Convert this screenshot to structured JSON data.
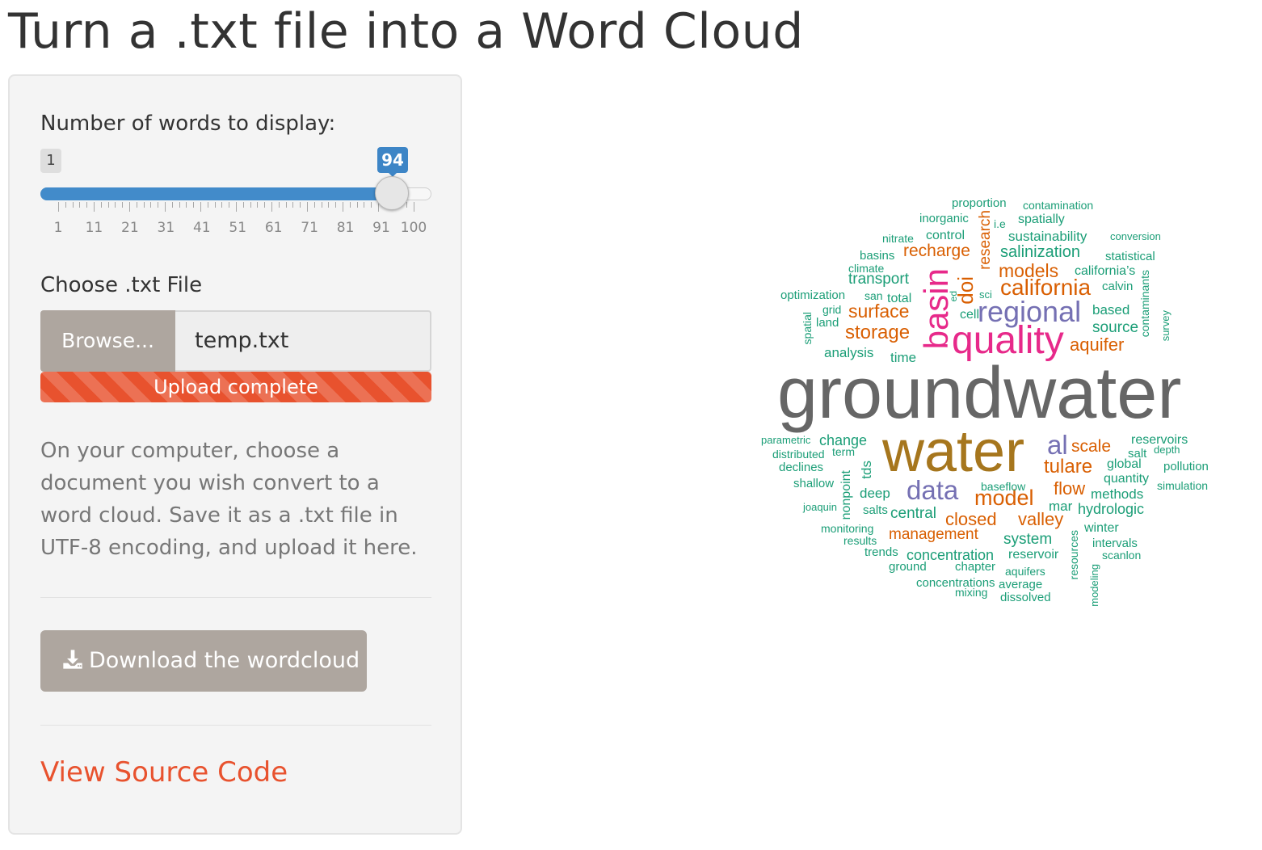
{
  "page": {
    "title": "Turn a .txt file into a Word Cloud"
  },
  "sidebar": {
    "slider": {
      "label": "Number of words to display:",
      "min": 1,
      "max": 100,
      "value": 94,
      "min_label": "1",
      "value_label": "94",
      "tick_labels": [
        "1",
        "11",
        "21",
        "31",
        "41",
        "51",
        "61",
        "71",
        "81",
        "91",
        "100"
      ]
    },
    "file_input": {
      "label": "Choose .txt File",
      "browse_label": "Browse...",
      "filename": "temp.txt",
      "progress_text": "Upload complete"
    },
    "help_text": "On your computer, choose a document you wish convert to a word cloud. Save it as a .txt file in UTF-8 encoding, and upload it here.",
    "download_label": "Download the wordcloud",
    "source_link": "View Source Code"
  },
  "colors": {
    "accent_blue": "#428bca",
    "orange": "#e8522e",
    "button_gray": "#aea69f",
    "cloud_teal": "#1b9e77",
    "cloud_orange": "#d95f02",
    "cloud_purple": "#7570b3",
    "cloud_pink": "#e7298a",
    "cloud_olive": "#a6761d",
    "cloud_gray": "#666666"
  },
  "wordcloud": {
    "words": [
      {
        "text": "groundwater",
        "color": "#666666"
      },
      {
        "text": "water",
        "color": "#a6761d"
      },
      {
        "text": "quality",
        "color": "#e7298a"
      },
      {
        "text": "basin",
        "color": "#e7298a"
      },
      {
        "text": "regional",
        "color": "#7570b3"
      },
      {
        "text": "data",
        "color": "#7570b3"
      },
      {
        "text": "al",
        "color": "#7570b3"
      },
      {
        "text": "doi",
        "color": "#d95f02"
      },
      {
        "text": "model",
        "color": "#d95f02"
      },
      {
        "text": "california",
        "color": "#d95f02"
      },
      {
        "text": "models",
        "color": "#d95f02"
      },
      {
        "text": "storage",
        "color": "#d95f02"
      },
      {
        "text": "surface",
        "color": "#d95f02"
      },
      {
        "text": "aquifer",
        "color": "#d95f02"
      },
      {
        "text": "tulare",
        "color": "#d95f02"
      },
      {
        "text": "recharge",
        "color": "#d95f02"
      },
      {
        "text": "research",
        "color": "#d95f02"
      },
      {
        "text": "scale",
        "color": "#d95f02"
      },
      {
        "text": "flow",
        "color": "#d95f02"
      },
      {
        "text": "closed",
        "color": "#d95f02"
      },
      {
        "text": "valley",
        "color": "#d95f02"
      },
      {
        "text": "management",
        "color": "#d95f02"
      },
      {
        "text": "salinization",
        "color": "#1b9e77"
      },
      {
        "text": "transport",
        "color": "#1b9e77"
      },
      {
        "text": "source",
        "color": "#1b9e77"
      },
      {
        "text": "sustainability",
        "color": "#1b9e77"
      },
      {
        "text": "control",
        "color": "#1b9e77"
      },
      {
        "text": "analysis",
        "color": "#1b9e77"
      },
      {
        "text": "time",
        "color": "#1b9e77"
      },
      {
        "text": "cell",
        "color": "#1b9e77"
      },
      {
        "text": "total",
        "color": "#1b9e77"
      },
      {
        "text": "san",
        "color": "#1b9e77"
      },
      {
        "text": "based",
        "color": "#1b9e77"
      },
      {
        "text": "calvin",
        "color": "#1b9e77"
      },
      {
        "text": "california’s",
        "color": "#1b9e77"
      },
      {
        "text": "statistical",
        "color": "#1b9e77"
      },
      {
        "text": "conversion",
        "color": "#1b9e77"
      },
      {
        "text": "spatially",
        "color": "#1b9e77"
      },
      {
        "text": "i.e",
        "color": "#1b9e77"
      },
      {
        "text": "inorganic",
        "color": "#1b9e77"
      },
      {
        "text": "proportion",
        "color": "#1b9e77"
      },
      {
        "text": "contamination",
        "color": "#1b9e77"
      },
      {
        "text": "nitrate",
        "color": "#1b9e77"
      },
      {
        "text": "basins",
        "color": "#1b9e77"
      },
      {
        "text": "climate",
        "color": "#1b9e77"
      },
      {
        "text": "optimization",
        "color": "#1b9e77"
      },
      {
        "text": "grid",
        "color": "#1b9e77"
      },
      {
        "text": "land",
        "color": "#1b9e77"
      },
      {
        "text": "spatial",
        "color": "#1b9e77"
      },
      {
        "text": "ed",
        "color": "#1b9e77"
      },
      {
        "text": "sci",
        "color": "#1b9e77"
      },
      {
        "text": "contaminants",
        "color": "#1b9e77"
      },
      {
        "text": "survey",
        "color": "#1b9e77"
      },
      {
        "text": "change",
        "color": "#1b9e77"
      },
      {
        "text": "parametric",
        "color": "#1b9e77"
      },
      {
        "text": "distributed",
        "color": "#1b9e77"
      },
      {
        "text": "term",
        "color": "#1b9e77"
      },
      {
        "text": "declines",
        "color": "#1b9e77"
      },
      {
        "text": "tds",
        "color": "#1b9e77"
      },
      {
        "text": "shallow",
        "color": "#1b9e77"
      },
      {
        "text": "nonpoint",
        "color": "#1b9e77"
      },
      {
        "text": "deep",
        "color": "#1b9e77"
      },
      {
        "text": "joaquin",
        "color": "#1b9e77"
      },
      {
        "text": "salts",
        "color": "#1b9e77"
      },
      {
        "text": "central",
        "color": "#1b9e77"
      },
      {
        "text": "baseflow",
        "color": "#1b9e77"
      },
      {
        "text": "mar",
        "color": "#1b9e77"
      },
      {
        "text": "hydrologic",
        "color": "#1b9e77"
      },
      {
        "text": "reservoirs",
        "color": "#1b9e77"
      },
      {
        "text": "depth",
        "color": "#1b9e77"
      },
      {
        "text": "salt",
        "color": "#1b9e77"
      },
      {
        "text": "global",
        "color": "#1b9e77"
      },
      {
        "text": "pollution",
        "color": "#1b9e77"
      },
      {
        "text": "quantity",
        "color": "#1b9e77"
      },
      {
        "text": "simulation",
        "color": "#1b9e77"
      },
      {
        "text": "methods",
        "color": "#1b9e77"
      },
      {
        "text": "monitoring",
        "color": "#1b9e77"
      },
      {
        "text": "results",
        "color": "#1b9e77"
      },
      {
        "text": "system",
        "color": "#1b9e77"
      },
      {
        "text": "winter",
        "color": "#1b9e77"
      },
      {
        "text": "intervals",
        "color": "#1b9e77"
      },
      {
        "text": "scanlon",
        "color": "#1b9e77"
      },
      {
        "text": "trends",
        "color": "#1b9e77"
      },
      {
        "text": "concentration",
        "color": "#1b9e77"
      },
      {
        "text": "reservoir",
        "color": "#1b9e77"
      },
      {
        "text": "ground",
        "color": "#1b9e77"
      },
      {
        "text": "chapter",
        "color": "#1b9e77"
      },
      {
        "text": "aquifers",
        "color": "#1b9e77"
      },
      {
        "text": "resources",
        "color": "#1b9e77"
      },
      {
        "text": "modeling",
        "color": "#1b9e77"
      },
      {
        "text": "concentrations",
        "color": "#1b9e77"
      },
      {
        "text": "average",
        "color": "#1b9e77"
      },
      {
        "text": "mixing",
        "color": "#1b9e77"
      },
      {
        "text": "dissolved",
        "color": "#1b9e77"
      }
    ]
  }
}
